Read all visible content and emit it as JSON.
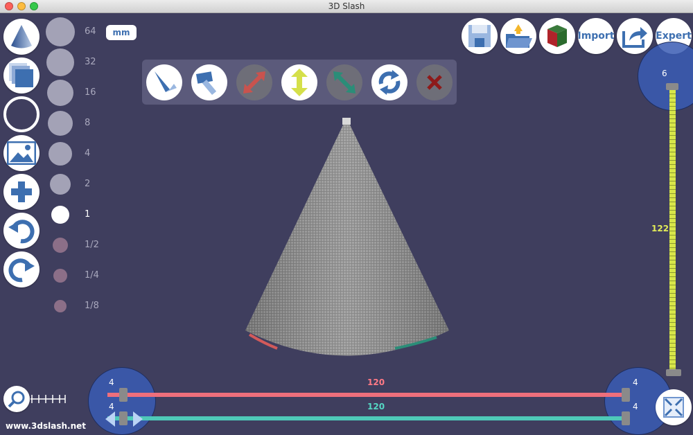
{
  "window": {
    "title": "3D Slash"
  },
  "sidebar": {
    "tools": [
      {
        "name": "cone-shape-button",
        "icon": "cone-icon"
      },
      {
        "name": "cube-shape-button",
        "icon": "cube-stack-icon"
      },
      {
        "name": "empty-shape-button",
        "icon": "ring-icon"
      },
      {
        "name": "image-button",
        "icon": "image-icon"
      },
      {
        "name": "add-button",
        "icon": "plus-icon"
      },
      {
        "name": "undo-button",
        "icon": "undo-icon"
      },
      {
        "name": "redo-button",
        "icon": "redo-icon"
      }
    ]
  },
  "sizes": {
    "unit": "mm",
    "items": [
      "64",
      "32",
      "16",
      "8",
      "4",
      "2",
      "1",
      "1/2",
      "1/4",
      "1/8"
    ],
    "active": "1"
  },
  "toolbar": {
    "tools": [
      "chisel-icon",
      "hammer-icon",
      "diagonal-arrow-icon",
      "vertical-arrow-icon",
      "diagonal-arrow-alt-icon",
      "rotate-icon",
      "close-icon"
    ]
  },
  "top_right": {
    "import_label": "Import",
    "expert_label": "Expert"
  },
  "vertical_slider": {
    "top_value": "6",
    "mid_value": "122"
  },
  "bottom_sliders": {
    "left_top": "4",
    "left_bottom": "4",
    "right_top": "4",
    "right_bottom": "4",
    "red_value": "120",
    "teal_value": "120"
  },
  "footer": {
    "website": "www.3dslash.net"
  },
  "colors": {
    "background": "#3f3e5e",
    "accent_blue": "#3d6fb0",
    "red_axis": "#ee6f7c",
    "teal_axis": "#4ec9b8",
    "yellow_axis": "#d8e64a"
  }
}
